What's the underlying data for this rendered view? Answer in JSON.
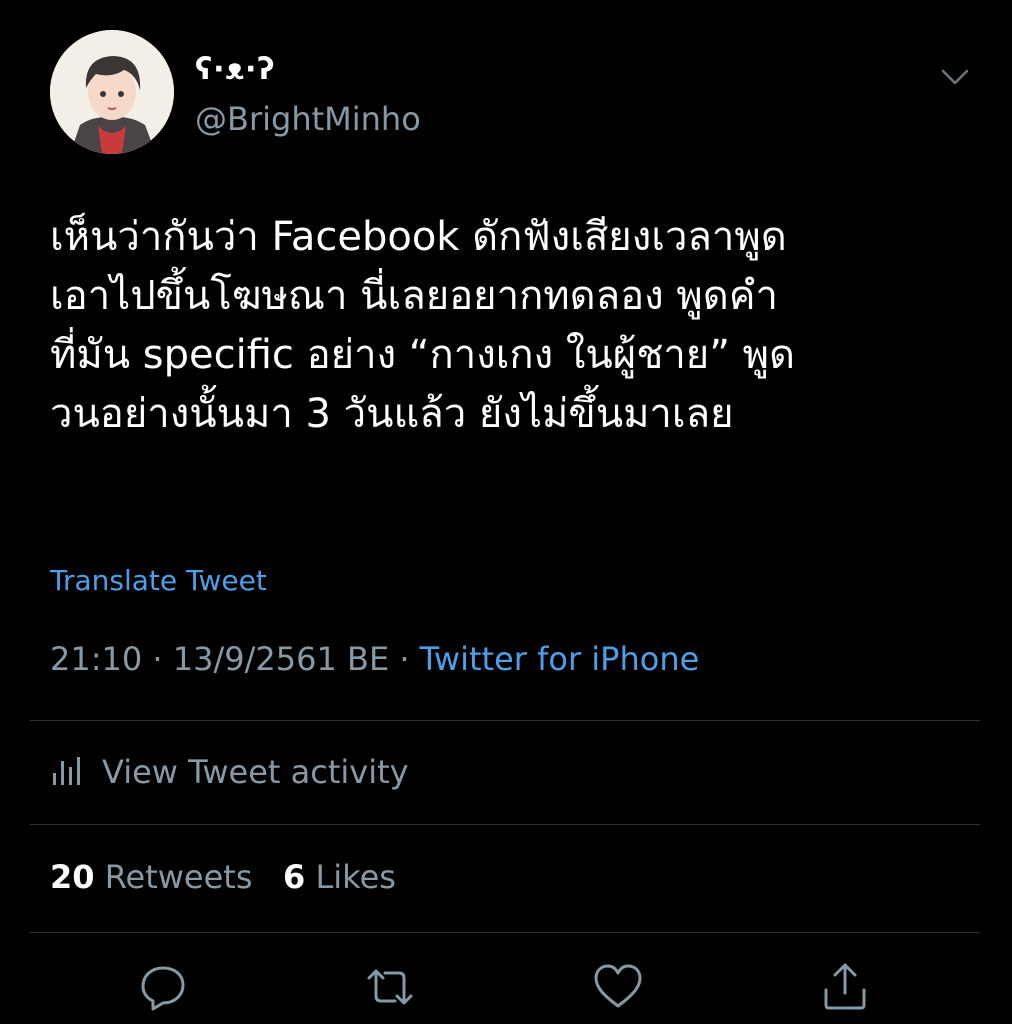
{
  "tweet": {
    "display_name": "ʕ·ᴥ·ʔ",
    "handle": "@BrightMinho",
    "text": "เห็นว่ากันว่า Facebook ดักฟังเสียงเวลาพูด\nเอาไปขึ้นโฆษณา นี่เลยอยากทดลอง พูดคำ\nที่มัน specific อย่าง “กางเกง ในผู้ชาย” พูด\nวนอย่างนั้นมา 3 วันแล้ว ยังไม่ขึ้นมาเลย",
    "translate_label": "Translate Tweet",
    "time": "21:10",
    "date": "13/9/2561 BE",
    "separator": " · ",
    "source": "Twitter for iPhone",
    "activity_label": "View Tweet activity",
    "retweets_count": "20",
    "retweets_label": "Retweets",
    "likes_count": "6",
    "likes_label": "Likes"
  },
  "icons": {
    "caret": "chevron-down-icon",
    "activity": "bar-chart-icon",
    "reply": "reply-icon",
    "retweet": "retweet-icon",
    "like": "heart-icon",
    "share": "share-icon"
  },
  "colors": {
    "background": "#000000",
    "text_primary": "#ffffff",
    "text_secondary": "#8899a6",
    "link": "#4d9fe8",
    "divider": "#2f3336"
  }
}
